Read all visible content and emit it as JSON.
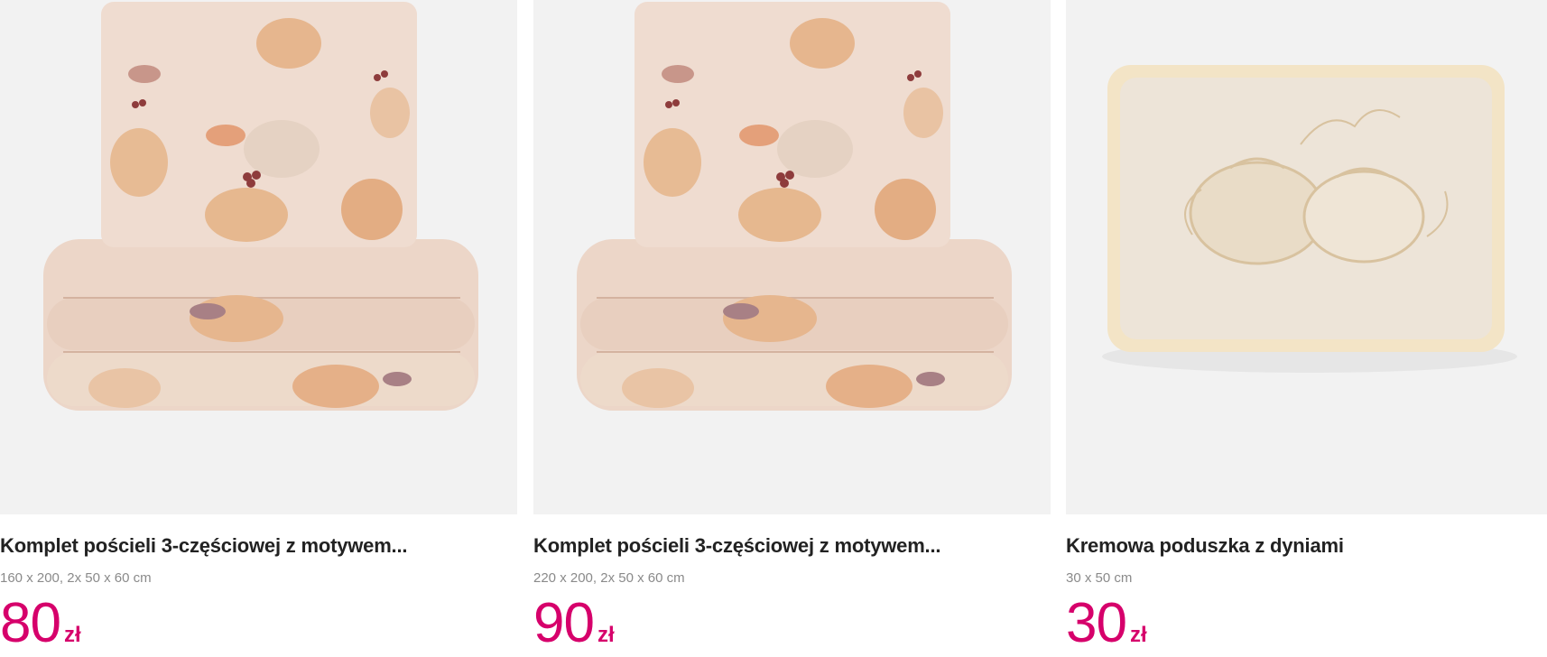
{
  "products": [
    {
      "title": "Komplet pościeli 3-częściowej z motywem...",
      "size": "160 x 200, 2x 50 x 60 cm",
      "price": "80",
      "currency": "zł",
      "image_icon": "bedding-set-pumpkin-pattern-image"
    },
    {
      "title": "Komplet pościeli 3-częściowej z motywem...",
      "size": "220 x 200, 2x 50 x 60 cm",
      "price": "90",
      "currency": "zł",
      "image_icon": "bedding-set-pumpkin-pattern-image"
    },
    {
      "title": "Kremowa poduszka z dyniami",
      "size": "30 x 50 cm",
      "price": "30",
      "currency": "zł",
      "image_icon": "cream-pumpkin-pillow-image"
    }
  ],
  "colors": {
    "price": "#d6006b",
    "title": "#222222",
    "size": "#8a8a8a",
    "image_bg": "#f2f2f2"
  }
}
